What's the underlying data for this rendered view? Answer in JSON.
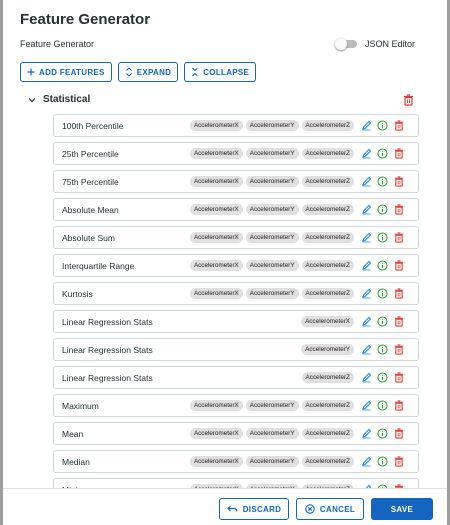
{
  "dialog": {
    "title": "Feature Generator",
    "subtitle": "Feature Generator",
    "json_editor_label": "JSON Editor",
    "json_editor_enabled": false
  },
  "toolbar": {
    "add_label": "ADD FEATURES",
    "expand_label": "EXPAND",
    "collapse_label": "COLLAPSE"
  },
  "section": {
    "title": "Statistical",
    "expanded": true
  },
  "features": [
    {
      "name": "100th Percentile",
      "inputs": [
        "AccelerometerX",
        "AccelerometerY",
        "AccelerometerZ"
      ]
    },
    {
      "name": "25th Percentile",
      "inputs": [
        "AccelerometerX",
        "AccelerometerY",
        "AccelerometerZ"
      ]
    },
    {
      "name": "75th Percentile",
      "inputs": [
        "AccelerometerX",
        "AccelerometerY",
        "AccelerometerZ"
      ]
    },
    {
      "name": "Absolute Mean",
      "inputs": [
        "AccelerometerX",
        "AccelerometerY",
        "AccelerometerZ"
      ]
    },
    {
      "name": "Absolute Sum",
      "inputs": [
        "AccelerometerX",
        "AccelerometerY",
        "AccelerometerZ"
      ]
    },
    {
      "name": "Interquartile Range",
      "inputs": [
        "AccelerometerX",
        "AccelerometerY",
        "AccelerometerZ"
      ]
    },
    {
      "name": "Kurtosis",
      "inputs": [
        "AccelerometerX",
        "AccelerometerY",
        "AccelerometerZ"
      ]
    },
    {
      "name": "Linear Regression Stats",
      "inputs": [
        "AccelerometerX"
      ]
    },
    {
      "name": "Linear Regression Stats",
      "inputs": [
        "AccelerometerY"
      ]
    },
    {
      "name": "Linear Regression Stats",
      "inputs": [
        "AccelerometerZ"
      ]
    },
    {
      "name": "Maximum",
      "inputs": [
        "AccelerometerX",
        "AccelerometerY",
        "AccelerometerZ"
      ]
    },
    {
      "name": "Mean",
      "inputs": [
        "AccelerometerX",
        "AccelerometerY",
        "AccelerometerZ"
      ]
    },
    {
      "name": "Median",
      "inputs": [
        "AccelerometerX",
        "AccelerometerY",
        "AccelerometerZ"
      ]
    },
    {
      "name": "Minimum",
      "inputs": [
        "AccelerometerX",
        "AccelerometerY",
        "AccelerometerZ"
      ]
    }
  ],
  "footer": {
    "discard_label": "DISCARD",
    "cancel_label": "CANCEL",
    "save_label": "SAVE"
  },
  "icons": {
    "add": "plus-icon",
    "expand": "unfold-more-icon",
    "collapse": "unfold-less-icon",
    "section_toggle": "chevron-down-icon",
    "edit": "pencil-icon",
    "info": "info-circle-icon",
    "delete": "trash-icon",
    "discard": "undo-icon",
    "cancel": "close-circle-icon"
  },
  "colors": {
    "primary": "#1565c0",
    "edit": "#1e88e5",
    "info": "#43a047",
    "delete": "#e53935"
  }
}
